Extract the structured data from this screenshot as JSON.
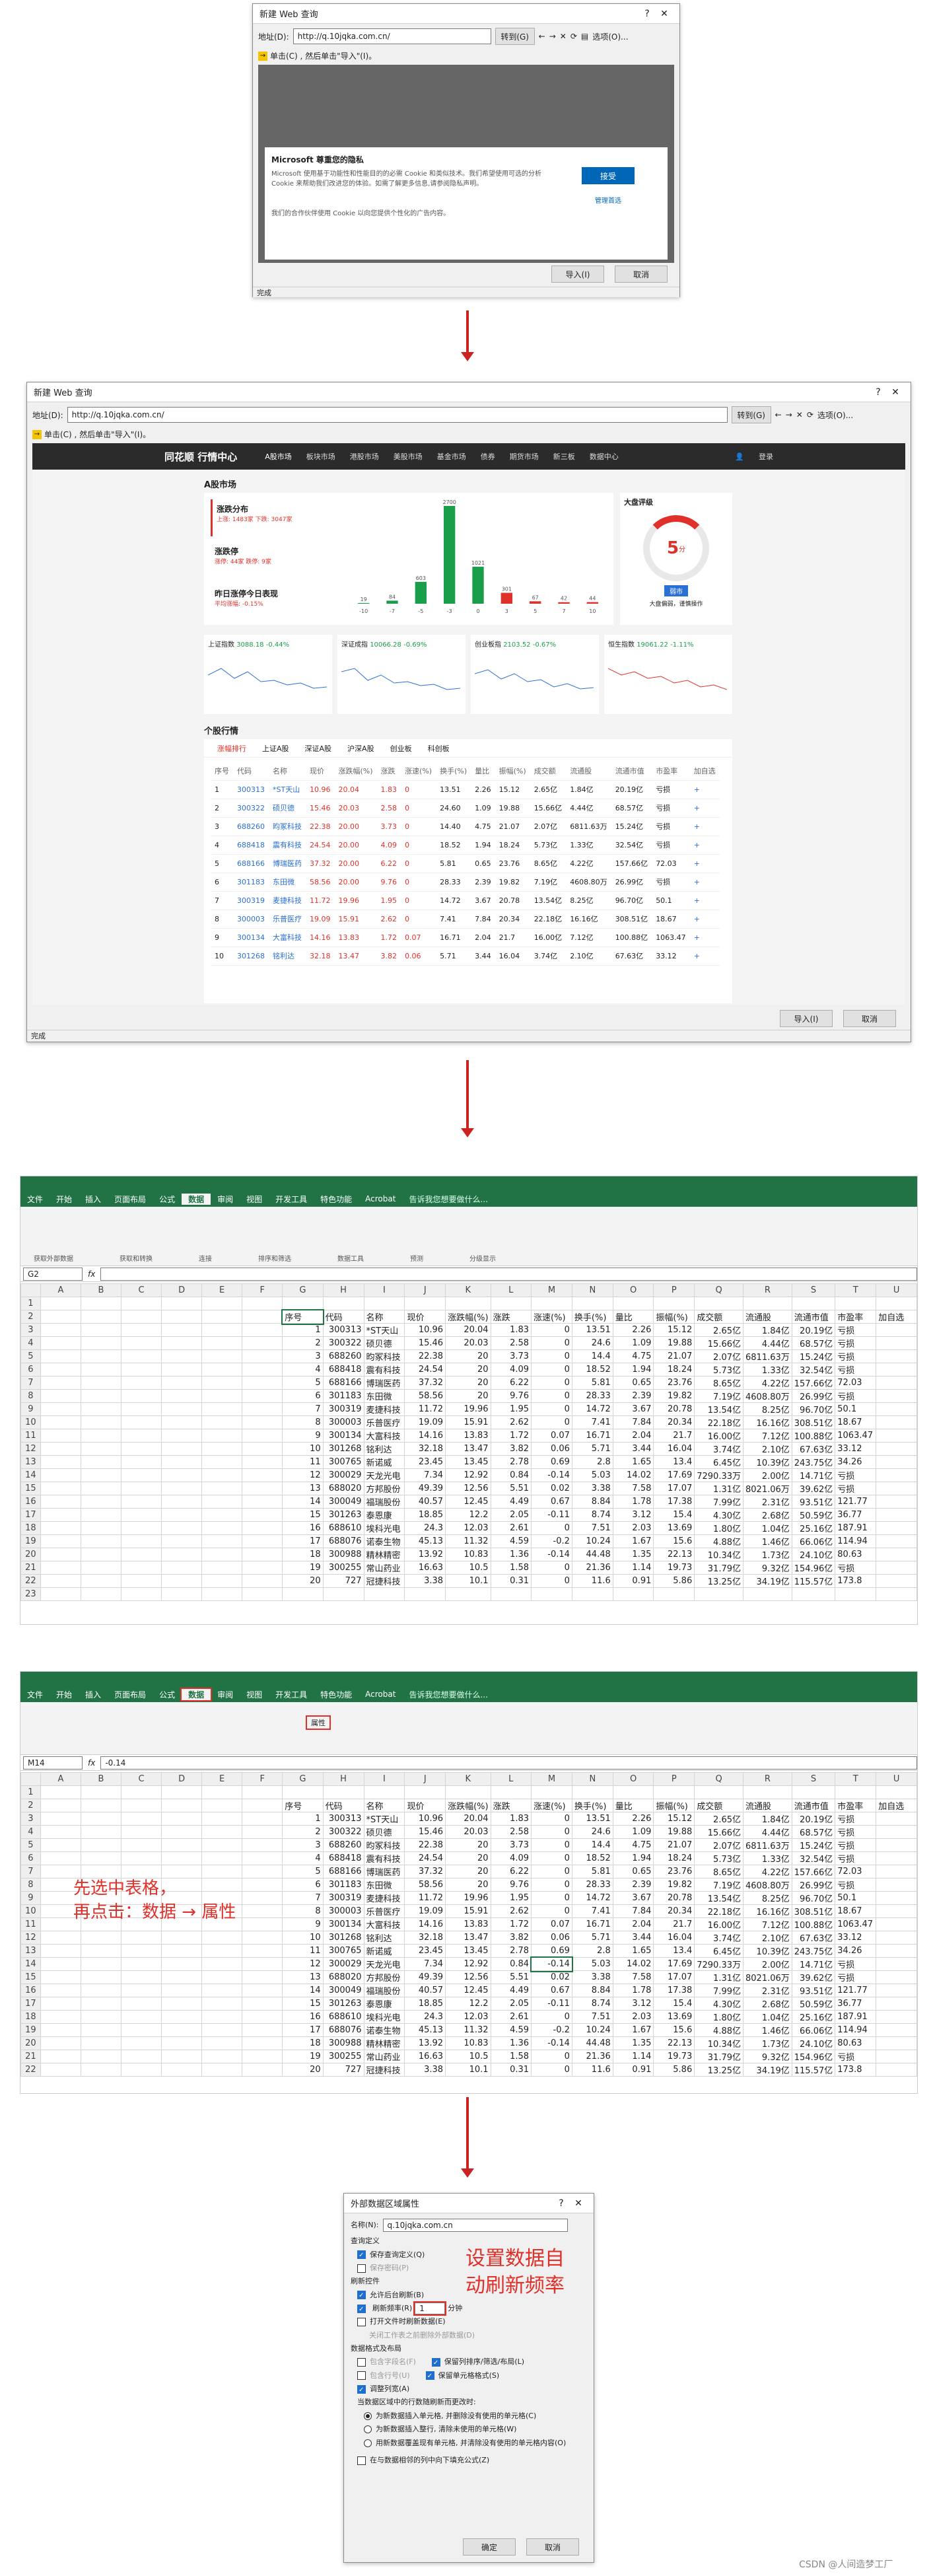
{
  "dialog1": {
    "title": "新建 Web 查询",
    "address_label": "地址(D):",
    "address_value": "http://q.10jqka.com.cn/",
    "go_button": "转到(G)",
    "options_button": "选项(O)...",
    "hint": "单击(C) , 然后单击\"导入\"(I)。",
    "cookie_title": "Microsoft 尊重您的隐私",
    "cookie_text": "Microsoft 使用基于功能性和性能目的的必需 Cookie 和类似技术。我们希望使用可选的分析 Cookie 来帮助我们改进您的体验。如需了解更多信息,请参阅隐私声明。",
    "accept_button": "接受",
    "manage_label": "管理首选",
    "cookie_text2": "我们的合作伙伴使用 Cookie 以向您提供个性化的广告内容。",
    "import_button": "导入(I)",
    "cancel_button": "取消",
    "status": "完成"
  },
  "dialog2": {
    "title": "新建 Web 查询",
    "address_label": "地址(D):",
    "address_value": "http://q.10jqka.com.cn/",
    "go_button": "转到(G)",
    "options_button": "选项(O)...",
    "hint": "单击(C) , 然后单击\"导入\"(I)。",
    "site_logo": "同花顺 行情中心",
    "nav": [
      "A股市场",
      "板块市场",
      "港股市场",
      "美股市场",
      "基金市场",
      "债券",
      "期货市场",
      "新三板",
      "数据中心"
    ],
    "login": "登录",
    "section1": "A股市场",
    "stat1_title": "涨跌分布",
    "stat1_text": "上涨: 1483家  下跌: 3047家",
    "stat2_title": "涨跌停",
    "stat2_text": "涨停: 44家  跌停: 9家",
    "stat3_title": "昨日涨停今日表现",
    "stat3_text": "平均涨幅: -0.15%",
    "bars": [
      {
        "label": "-10",
        "value": 19
      },
      {
        "label": "-7",
        "value": 84
      },
      {
        "label": "-5",
        "value": 603
      },
      {
        "label": "-3",
        "value": 2700
      },
      {
        "label": "0",
        "value": 1021
      },
      {
        "label": "3",
        "value": 301
      },
      {
        "label": "5",
        "value": 67
      },
      {
        "label": "7",
        "value": 42
      },
      {
        "label": "10",
        "value": 44
      }
    ],
    "gauge_title": "大盘评级",
    "gauge_value": "5",
    "gauge_unit": "分",
    "gauge_btn": "弱市",
    "gauge_text": "大盘偏弱，谨慎操作",
    "indexes": [
      {
        "name": "上证指数",
        "value": "3088.18",
        "chg": "-0.44%"
      },
      {
        "name": "深证成指",
        "value": "10066.28",
        "chg": "-0.69%"
      },
      {
        "name": "创业板指",
        "value": "2103.52",
        "chg": "-0.67%"
      },
      {
        "name": "恒生指数",
        "value": "19061.22",
        "chg": "-1.11%"
      }
    ],
    "section2": "个股行情",
    "tabs": [
      "涨幅排行",
      "上证A股",
      "深证A股",
      "沪深A股",
      "创业板",
      "科创板"
    ],
    "headers": [
      "序号",
      "代码",
      "名称",
      "现价",
      "涨跌幅(%)",
      "涨跌",
      "涨速(%)",
      "换手(%)",
      "量比",
      "振幅(%)",
      "成交额",
      "流通股",
      "流通市值",
      "市盈率",
      "加自选"
    ],
    "rows": [
      [
        "1",
        "300313",
        "*ST天山",
        "10.96",
        "20.04",
        "1.83",
        "0",
        "13.51",
        "2.26",
        "15.12",
        "2.65亿",
        "1.84亿",
        "20.19亿",
        "亏损",
        "+"
      ],
      [
        "2",
        "300322",
        "硕贝德",
        "15.46",
        "20.03",
        "2.58",
        "0",
        "24.60",
        "1.09",
        "19.88",
        "15.66亿",
        "4.44亿",
        "68.57亿",
        "亏损",
        "+"
      ],
      [
        "3",
        "688260",
        "昀冢科技",
        "22.38",
        "20.00",
        "3.73",
        "0",
        "14.40",
        "4.75",
        "21.07",
        "2.07亿",
        "6811.63万",
        "15.24亿",
        "亏损",
        "+"
      ],
      [
        "4",
        "688418",
        "震有科技",
        "24.54",
        "20.00",
        "4.09",
        "0",
        "18.52",
        "1.94",
        "18.24",
        "5.73亿",
        "1.33亿",
        "32.54亿",
        "亏损",
        "+"
      ],
      [
        "5",
        "688166",
        "博瑞医药",
        "37.32",
        "20.00",
        "6.22",
        "0",
        "5.81",
        "0.65",
        "23.76",
        "8.65亿",
        "4.22亿",
        "157.66亿",
        "72.03",
        "+"
      ],
      [
        "6",
        "301183",
        "东田微",
        "58.56",
        "20.00",
        "9.76",
        "0",
        "28.33",
        "2.39",
        "19.82",
        "7.19亿",
        "4608.80万",
        "26.99亿",
        "亏损",
        "+"
      ],
      [
        "7",
        "300319",
        "麦捷科技",
        "11.72",
        "19.96",
        "1.95",
        "0",
        "14.72",
        "3.67",
        "20.78",
        "13.54亿",
        "8.25亿",
        "96.70亿",
        "50.1",
        "+"
      ],
      [
        "8",
        "300003",
        "乐普医疗",
        "19.09",
        "15.91",
        "2.62",
        "0",
        "7.41",
        "7.84",
        "20.34",
        "22.18亿",
        "16.16亿",
        "308.51亿",
        "18.67",
        "+"
      ],
      [
        "9",
        "300134",
        "大富科技",
        "14.16",
        "13.83",
        "1.72",
        "0.07",
        "16.71",
        "2.04",
        "21.7",
        "16.00亿",
        "7.12亿",
        "100.88亿",
        "1063.47",
        "+"
      ],
      [
        "10",
        "301268",
        "铭利达",
        "32.18",
        "13.47",
        "3.82",
        "0.06",
        "5.71",
        "3.44",
        "16.04",
        "3.74亿",
        "2.10亿",
        "67.63亿",
        "33.12",
        "+"
      ]
    ],
    "import_button": "导入(I)",
    "cancel_button": "取消",
    "status": "完成"
  },
  "excel1": {
    "tabs": [
      "文件",
      "开始",
      "插入",
      "页面布局",
      "公式",
      "数据",
      "审阅",
      "视图",
      "开发工具",
      "特色功能",
      "Acrobat"
    ],
    "search": "告诉我您想要做什么...",
    "groups": [
      "获取外部数据",
      "获取和转换",
      "连接",
      "排序和筛选",
      "数据工具",
      "预测",
      "分级显示"
    ],
    "name_box": "G2",
    "formula": "",
    "col_letters": [
      "A",
      "B",
      "C",
      "D",
      "E",
      "F",
      "G",
      "H",
      "I",
      "J",
      "K",
      "L",
      "M",
      "N",
      "O",
      "P",
      "Q",
      "R",
      "S",
      "T",
      "U"
    ],
    "headers": [
      "序号",
      "代码",
      "名称",
      "现价",
      "涨跌幅(%)",
      "涨跌",
      "涨速(%)",
      "换手(%)",
      "量比",
      "振幅(%)",
      "成交额",
      "流通股",
      "流通市值",
      "市盈率",
      "加自选"
    ],
    "rows": [
      [
        "1",
        "300313",
        "*ST天山",
        "10.96",
        "20.04",
        "1.83",
        "0",
        "13.51",
        "2.26",
        "15.12",
        "2.65亿",
        "1.84亿",
        "20.19亿",
        "亏损"
      ],
      [
        "2",
        "300322",
        "硕贝德",
        "15.46",
        "20.03",
        "2.58",
        "0",
        "24.6",
        "1.09",
        "19.88",
        "15.66亿",
        "4.44亿",
        "68.57亿",
        "亏损"
      ],
      [
        "3",
        "688260",
        "昀冢科技",
        "22.38",
        "20",
        "3.73",
        "0",
        "14.4",
        "4.75",
        "21.07",
        "2.07亿",
        "6811.63万",
        "15.24亿",
        "亏损"
      ],
      [
        "4",
        "688418",
        "震有科技",
        "24.54",
        "20",
        "4.09",
        "0",
        "18.52",
        "1.94",
        "18.24",
        "5.73亿",
        "1.33亿",
        "32.54亿",
        "亏损"
      ],
      [
        "5",
        "688166",
        "博瑞医药",
        "37.32",
        "20",
        "6.22",
        "0",
        "5.81",
        "0.65",
        "23.76",
        "8.65亿",
        "4.22亿",
        "157.66亿",
        "72.03"
      ],
      [
        "6",
        "301183",
        "东田微",
        "58.56",
        "20",
        "9.76",
        "0",
        "28.33",
        "2.39",
        "19.82",
        "7.19亿",
        "4608.80万",
        "26.99亿",
        "亏损"
      ],
      [
        "7",
        "300319",
        "麦捷科技",
        "11.72",
        "19.96",
        "1.95",
        "0",
        "14.72",
        "3.67",
        "20.78",
        "13.54亿",
        "8.25亿",
        "96.70亿",
        "50.1"
      ],
      [
        "8",
        "300003",
        "乐普医疗",
        "19.09",
        "15.91",
        "2.62",
        "0",
        "7.41",
        "7.84",
        "20.34",
        "22.18亿",
        "16.16亿",
        "308.51亿",
        "18.67"
      ],
      [
        "9",
        "300134",
        "大富科技",
        "14.16",
        "13.83",
        "1.72",
        "0.07",
        "16.71",
        "2.04",
        "21.7",
        "16.00亿",
        "7.12亿",
        "100.88亿",
        "1063.47"
      ],
      [
        "10",
        "301268",
        "铭利达",
        "32.18",
        "13.47",
        "3.82",
        "0.06",
        "5.71",
        "3.44",
        "16.04",
        "3.74亿",
        "2.10亿",
        "67.63亿",
        "33.12"
      ],
      [
        "11",
        "300765",
        "新诺威",
        "23.45",
        "13.45",
        "2.78",
        "0.69",
        "2.8",
        "1.65",
        "13.4",
        "6.45亿",
        "10.39亿",
        "243.75亿",
        "34.26"
      ],
      [
        "12",
        "300029",
        "天龙光电",
        "7.34",
        "12.92",
        "0.84",
        "-0.14",
        "5.03",
        "14.02",
        "17.69",
        "7290.33万",
        "2.00亿",
        "14.71亿",
        "亏损"
      ],
      [
        "13",
        "688020",
        "方邦股份",
        "49.39",
        "12.56",
        "5.51",
        "0.02",
        "3.38",
        "7.58",
        "17.07",
        "1.31亿",
        "8021.06万",
        "39.62亿",
        "亏损"
      ],
      [
        "14",
        "300049",
        "福瑞股份",
        "40.57",
        "12.45",
        "4.49",
        "0.67",
        "8.84",
        "1.78",
        "17.38",
        "7.99亿",
        "2.31亿",
        "93.51亿",
        "121.77"
      ],
      [
        "15",
        "301263",
        "泰恩康",
        "18.85",
        "12.2",
        "2.05",
        "-0.11",
        "8.74",
        "3.12",
        "15.4",
        "4.30亿",
        "2.68亿",
        "50.59亿",
        "36.77"
      ],
      [
        "16",
        "688610",
        "埃科光电",
        "24.3",
        "12.03",
        "2.61",
        "0",
        "7.51",
        "2.03",
        "13.69",
        "1.80亿",
        "1.04亿",
        "25.16亿",
        "187.91"
      ],
      [
        "17",
        "688076",
        "诺泰生物",
        "45.13",
        "11.32",
        "4.59",
        "-0.2",
        "10.24",
        "1.67",
        "15.6",
        "4.88亿",
        "1.46亿",
        "66.06亿",
        "114.94"
      ],
      [
        "18",
        "300988",
        "精林精密",
        "13.92",
        "10.83",
        "1.36",
        "-0.14",
        "44.48",
        "1.35",
        "22.13",
        "10.34亿",
        "1.73亿",
        "24.10亿",
        "80.63"
      ],
      [
        "19",
        "300255",
        "常山药业",
        "16.63",
        "10.5",
        "1.58",
        "0",
        "21.36",
        "1.14",
        "19.73",
        "31.79亿",
        "9.32亿",
        "154.96亿",
        "亏损"
      ],
      [
        "20",
        "727",
        "冠捷科技",
        "3.38",
        "10.1",
        "0.31",
        "0",
        "11.6",
        "0.91",
        "5.86",
        "13.25亿",
        "34.19亿",
        "115.57亿",
        "173.8"
      ]
    ]
  },
  "excel2": {
    "name_box": "M14",
    "formula": "-0.14",
    "annotation": "先选中表格，\n再点击：数据 → 属性",
    "props_label": "属性"
  },
  "dialog3": {
    "title": "外部数据区域属性",
    "name_label": "名称(N):",
    "name_value": "q.10jqka.com.cn",
    "query_def": "查询定义",
    "save_query": "保存查询定义(Q)",
    "save_pwd": "保存密码(P)",
    "refresh_ctrl": "刷新控件",
    "bg_refresh": "允许后台刷新(B)",
    "refresh_freq": "刷新频率(R)",
    "refresh_minutes": "1",
    "refresh_unit": "分钟",
    "open_refresh": "打开文件时刷新数据(E)",
    "remove_data": "关闭工作表之前删除外部数据(D)",
    "format_layout": "数据格式及布局",
    "incl_field": "包含字段名(F)",
    "keep_col": "保留列排序/筛选/布局(L)",
    "incl_row": "包含行号(U)",
    "keep_cell": "保留单元格格式(S)",
    "adjust_width": "调整列宽(A)",
    "change_rows": "当数据区域中的行数随刷新而更改时:",
    "opt1": "为新数据插入单元格, 并删除没有使用的单元格(C)",
    "opt2": "为新数据插入整行, 清除未使用的单元格(W)",
    "opt3": "用新数据覆盖现有单元格, 并清除没有使用的单元格内容(O)",
    "fill_down": "在与数据相邻的列中向下填充公式(Z)",
    "ok_button": "确定",
    "cancel_button": "取消",
    "annotation": "设置数据自\n动刷新频率"
  },
  "watermark": "CSDN @人间造梦工厂"
}
